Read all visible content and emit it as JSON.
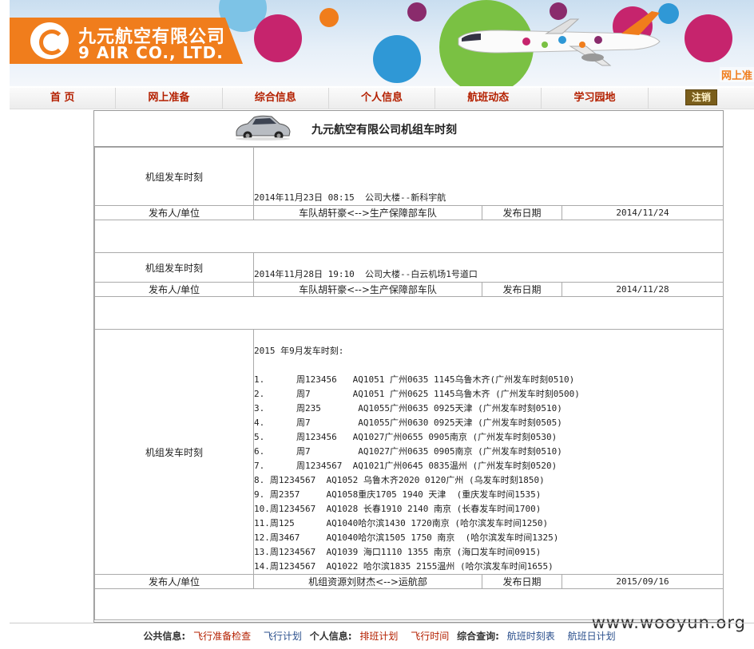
{
  "banner": {
    "company_cn": "九元航空有限公司",
    "company_en": "9 AIR CO., LTD.",
    "corner_text": "网上准"
  },
  "nav": {
    "items": [
      "首 页",
      "网上准备",
      "综合信息",
      "个人信息",
      "航班动态",
      "学习园地"
    ],
    "logout": "注销"
  },
  "panel": {
    "title": "九元航空有限公司机组车时刻"
  },
  "notices": [
    {
      "label": "机组发车时刻",
      "content": "2014年11月23日 08:15  公司大楼--新科宇航",
      "publisher_label": "发布人/单位",
      "publisher": "车队胡轩豪<-->生产保障部车队",
      "date_label": "发布日期",
      "date": "2014/11/24"
    },
    {
      "label": "机组发车时刻",
      "content": "2014年11月28日 19:10  公司大楼--白云机场1号道口",
      "publisher_label": "发布人/单位",
      "publisher": "车队胡轩豪<-->生产保障部车队",
      "date_label": "发布日期",
      "date": "2014/11/28"
    },
    {
      "label": "机组发车时刻",
      "content": "2015 年9月发车时刻:\n\n1.      周123456   AQ1051 广州0635 1145乌鲁木齐(广州发车时刻0510)\n2.      周7        AQ1051 广州0625 1145乌鲁木齐 (广州发车时刻0500)\n3.      周235       AQ1055广州0635 0925天津 (广州发车时刻0510)\n4.      周7         AQ1055广州0630 0925天津 (广州发车时刻0505)\n5.      周123456   AQ1027广州0655 0905南京 (广州发车时刻0530)\n6.      周7         AQ1027广州0635 0905南京 (广州发车时刻0510)\n7.      周1234567  AQ1021广州0645 0835温州 (广州发车时刻0520)\n8. 周1234567  AQ1052 乌鲁木齐2020 0120广州 (乌发车时刻1850)\n9. 周2357     AQ1058重庆1705 1940 天津  (重庆发车时间1535)\n10.周1234567  AQ1028 长春1910 2140 南京 (长春发车时间1700)\n11.周125      AQ1040哈尔滨1430 1720南京 (哈尔滨发车时间1250)\n12.周3467     AQ1040哈尔滨1505 1750 南京  (哈尔滨发车时间1325)\n13.周1234567  AQ1039 海口1110 1355 南京 (海口发车时间0915)\n14.周1234567  AQ1022 哈尔滨1835 2155温州 (哈尔滨发车时间1655)",
      "publisher_label": "发布人/单位",
      "publisher": "机组资源刘财杰<-->运航部",
      "date_label": "发布日期",
      "date": "2015/09/16"
    }
  ],
  "footer": {
    "public_label": "公共信息:",
    "public_links": [
      "飞行准备检查",
      "飞行计划"
    ],
    "personal_label": "个人信息:",
    "personal_links": [
      "排班计划",
      "飞行时间"
    ],
    "query_label": "综合查询:",
    "query_links": [
      "航班时刻表",
      "航班日计划"
    ]
  },
  "watermark": "www.wooyun.org",
  "colors": {
    "brand_orange": "#f07d1c",
    "nav_text": "#b42000",
    "link_blue": "#2a4f8c"
  }
}
